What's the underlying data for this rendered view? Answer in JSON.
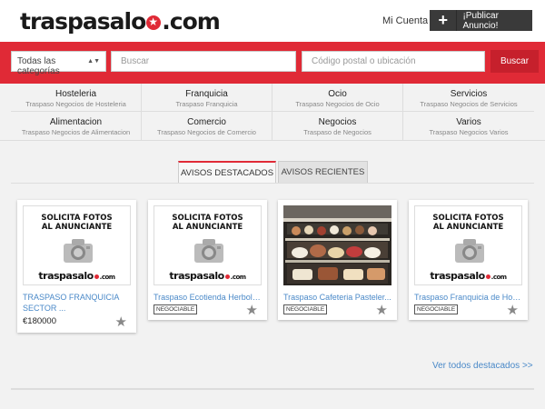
{
  "header": {
    "logo_left": "traspasalo",
    "logo_right": ".com",
    "account_label": "Mi Cuenta",
    "publish_label": "¡Publicar Anuncio!"
  },
  "search": {
    "category_value": "Todas las categorías",
    "search_placeholder": "Buscar",
    "location_placeholder": "Código postal o ubicación",
    "button_label": "Buscar"
  },
  "categories": [
    {
      "title": "Hosteleria",
      "sub": "Traspaso Negocios de Hosteleria"
    },
    {
      "title": "Franquicia",
      "sub": "Traspaso Franquicia"
    },
    {
      "title": "Ocio",
      "sub": "Traspaso Negocios de Ocio"
    },
    {
      "title": "Servicios",
      "sub": "Traspaso Negocios de Servicios"
    },
    {
      "title": "Alimentacion",
      "sub": "Traspaso Negocios de Alimentacion"
    },
    {
      "title": "Comercio",
      "sub": "Traspaso Negocios de Comercio"
    },
    {
      "title": "Negocios",
      "sub": "Traspaso de Negocios"
    },
    {
      "title": "Varios",
      "sub": "Traspaso Negocios Varios"
    }
  ],
  "tabs": {
    "featured": "AVISOS DESTACADOS",
    "recent": "AVISOS RECIENTES"
  },
  "placeholder": {
    "line1": "SOLICITA FOTOS",
    "line2": "AL ANUNCIANTE",
    "logo_left": "traspasalo",
    "logo_right": ".com"
  },
  "listings": [
    {
      "title": "TRASPASO FRANQUICIA SECTOR ...",
      "price": "€180000",
      "badge": ""
    },
    {
      "title": "Traspaso Ecotienda Herbolar...",
      "price": "",
      "badge": "NEGOCIABLE"
    },
    {
      "title": "Traspaso Cafeteria Pasteler...",
      "price": "",
      "badge": "NEGOCIABLE"
    },
    {
      "title": "Traspaso Franquicia de Host...",
      "price": "",
      "badge": "NEGOCIABLE"
    }
  ],
  "see_all": "Ver todos destacados >>",
  "colors": {
    "brand": "#e02a36",
    "link": "#4a89c8",
    "dark_button": "#3a3a3a"
  }
}
